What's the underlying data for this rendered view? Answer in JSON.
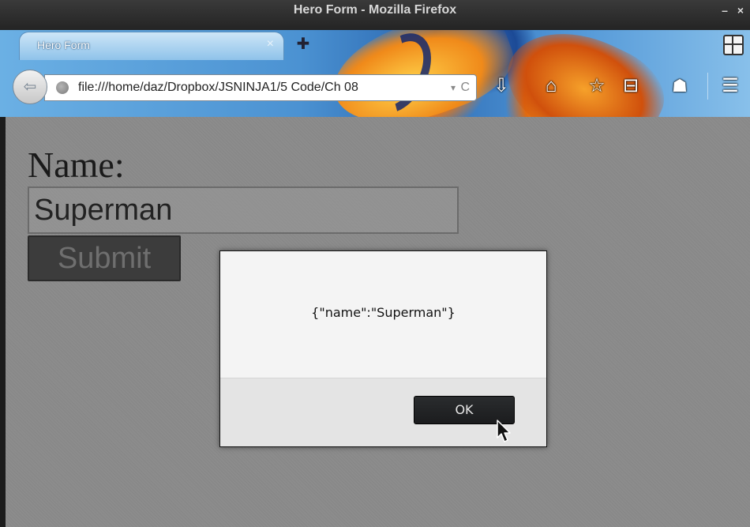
{
  "window": {
    "title": "Hero Form - Mozilla Firefox",
    "controls": "– ×"
  },
  "tab": {
    "title": "Hero Form",
    "close_glyph": "×",
    "new_tab_glyph": "✚"
  },
  "navbar": {
    "back_glyph": "⇦",
    "url": "file:///home/daz/Dropbox/JSNINJA1/5 Code/Ch 08",
    "dropmarker_glyph": "▾",
    "reload_glyph": "C",
    "icons": {
      "download": "⇩",
      "home": "⌂",
      "bookmark": "☆",
      "reading_list": "⊟",
      "ghost": "☗",
      "menu": "☰"
    }
  },
  "page": {
    "name_label": "Name:",
    "name_value": "Superman",
    "submit_label": "Submit"
  },
  "alert": {
    "message": "{\"name\":\"Superman\"}",
    "ok_label": "OK"
  }
}
